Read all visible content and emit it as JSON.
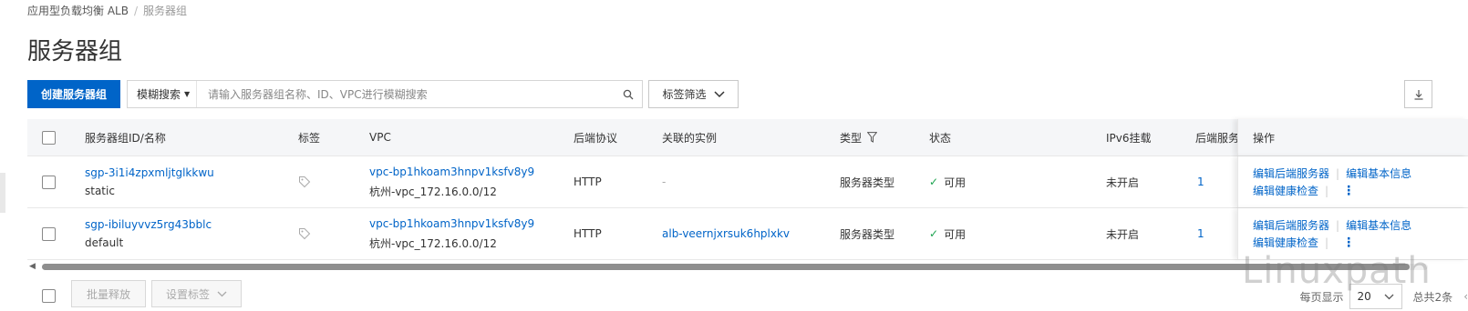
{
  "breadcrumb": {
    "parent": "应用型负载均衡 ALB",
    "separator": "/",
    "current": "服务器组"
  },
  "page_title": "服务器组",
  "toolbar": {
    "create_label": "创建服务器组",
    "search_type": "模糊搜索",
    "search_placeholder": "请输入服务器组名称、ID、VPC进行模糊搜索",
    "tag_filter_label": "标签筛选"
  },
  "table": {
    "headers": {
      "id_name": "服务器组ID/名称",
      "tags": "标签",
      "vpc": "VPC",
      "protocol": "后端协议",
      "instance": "关联的实例",
      "type": "类型",
      "status": "状态",
      "ipv6": "IPv6挂载",
      "backend": "后端服务",
      "ops": "操作"
    },
    "rows": [
      {
        "id": "sgp-3i1i4zpxmljtglkkwu",
        "name": "static",
        "vpc_id": "vpc-bp1hkoam3hnpv1ksfv8y9",
        "vpc_name": "杭州-vpc_172.16.0.0/12",
        "protocol": "HTTP",
        "instance": "-",
        "type": "服务器类型",
        "status": "可用",
        "ipv6": "未开启",
        "backend_count": "1",
        "op_edit_backend": "编辑后端服务器",
        "op_edit_basic": "编辑基本信息",
        "op_edit_health": "编辑健康检查"
      },
      {
        "id": "sgp-ibiluyvvz5rg43bblc",
        "name": "default",
        "vpc_id": "vpc-bp1hkoam3hnpv1ksfv8y9",
        "vpc_name": "杭州-vpc_172.16.0.0/12",
        "protocol": "HTTP",
        "instance": "alb-veernjxrsuk6hplxkv",
        "type": "服务器类型",
        "status": "可用",
        "ipv6": "未开启",
        "backend_count": "1",
        "op_edit_backend": "编辑后端服务器",
        "op_edit_basic": "编辑基本信息",
        "op_edit_health": "编辑健康检查"
      }
    ]
  },
  "footer": {
    "batch_release": "批量释放",
    "set_tags": "设置标签",
    "page_size_label": "每页显示",
    "page_size": "20",
    "total": "总共2条"
  },
  "watermark": "Linuxpath",
  "colors": {
    "primary": "#0064c8",
    "success": "#1ca34f",
    "header_bg": "#f5f6f8"
  }
}
